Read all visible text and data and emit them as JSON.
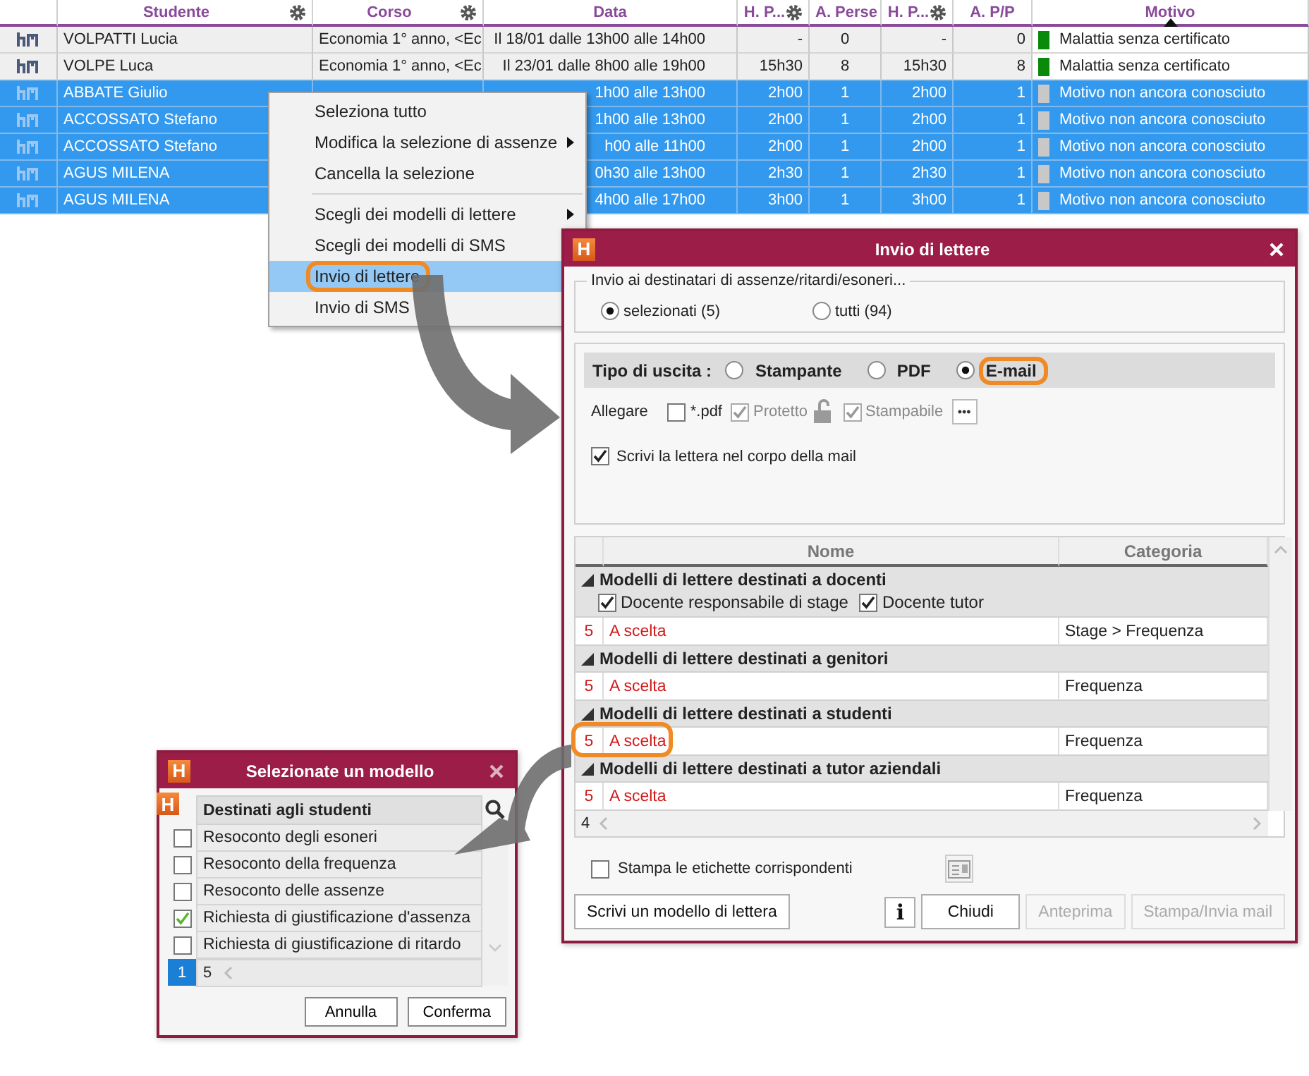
{
  "table": {
    "columns": [
      {
        "gear": false
      },
      {
        "label": "Studente",
        "gear": true
      },
      {
        "label": "Corso",
        "gear": true
      },
      {
        "label": "Data",
        "gear": false
      },
      {
        "label": "H. P...",
        "gear": true
      },
      {
        "label": "A. Perse",
        "gear": false
      },
      {
        "label": "H. P...",
        "gear": true
      },
      {
        "label": "A. P/P",
        "gear": false
      },
      {
        "label": "Motivo",
        "gear": false
      }
    ],
    "rows": [
      {
        "selected": false,
        "studente": "VOLPATTI Lucia",
        "corso": "Economia 1° anno, <Ec",
        "data": "Il 18/01 dalle 13h00 alle 14h00",
        "h_p_1": "-",
        "a_perse": "0",
        "h_p_2": "-",
        "a_p_p": "0",
        "motivo": "Malattia senza certificato",
        "color": "#0a8a0a"
      },
      {
        "selected": false,
        "studente": "VOLPE Luca",
        "corso": "Economia 1° anno, <Ec",
        "data": "Il 23/01 dalle 8h00 alle 19h00",
        "h_p_1": "15h30",
        "a_perse": "8",
        "h_p_2": "15h30",
        "a_p_p": "8",
        "motivo": "Malattia senza certificato",
        "color": "#0a8a0a"
      },
      {
        "selected": true,
        "studente": "ABBATE Giulio",
        "data": "1h00 alle 13h00",
        "h_p_1": "2h00",
        "a_perse": "1",
        "h_p_2": "2h00",
        "a_p_p": "1",
        "motivo": "Motivo non ancora conosciuto",
        "color": "#c8c8c8"
      },
      {
        "selected": true,
        "studente": "ACCOSSATO Stefano",
        "data": "1h00 alle 13h00",
        "h_p_1": "2h00",
        "a_perse": "1",
        "h_p_2": "2h00",
        "a_p_p": "1",
        "motivo": "Motivo non ancora conosciuto",
        "color": "#c8c8c8"
      },
      {
        "selected": true,
        "studente": "ACCOSSATO Stefano",
        "data": "h00 alle 11h00",
        "h_p_1": "2h00",
        "a_perse": "1",
        "h_p_2": "2h00",
        "a_p_p": "1",
        "motivo": "Motivo non ancora conosciuto",
        "color": "#c8c8c8"
      },
      {
        "selected": true,
        "studente": "AGUS MILENA",
        "data": "0h30 alle 13h00",
        "h_p_1": "2h30",
        "a_perse": "1",
        "h_p_2": "2h30",
        "a_p_p": "1",
        "motivo": "Motivo non ancora conosciuto",
        "color": "#c8c8c8"
      },
      {
        "selected": true,
        "studente": "AGUS MILENA",
        "data": "4h00 alle 17h00",
        "h_p_1": "3h00",
        "a_perse": "1",
        "h_p_2": "3h00",
        "a_p_p": "1",
        "motivo": "Motivo non ancora conosciuto",
        "color": "#c8c8c8"
      }
    ]
  },
  "context_menu": {
    "items": [
      {
        "kind": "item",
        "label": "Seleziona tutto",
        "submenu": false,
        "selected": false,
        "highlighted": false
      },
      {
        "kind": "item",
        "label": "Modifica la selezione di assenze",
        "submenu": true,
        "selected": false,
        "highlighted": false
      },
      {
        "kind": "item",
        "label": "Cancella la selezione",
        "submenu": false,
        "selected": false,
        "highlighted": false
      },
      {
        "kind": "separator"
      },
      {
        "kind": "item",
        "label": "Scegli dei modelli di lettere",
        "submenu": true,
        "selected": false,
        "highlighted": false
      },
      {
        "kind": "item",
        "label": "Scegli dei modelli di SMS",
        "selected": false,
        "highlighted": false
      },
      {
        "kind": "item",
        "label": "Invio di lettere",
        "selected": true,
        "highlighted": true
      },
      {
        "kind": "item",
        "label": "Invio di SMS",
        "selected": false,
        "highlighted": false
      }
    ]
  },
  "letters_dialog": {
    "logo": "H",
    "title": "Invio di lettere",
    "recipients": {
      "legend": "Invio ai destinatari di assenze/ritardi/esoneri...",
      "options": [
        {
          "label": "selezionati (5)",
          "selected": true
        },
        {
          "label": "tutti (94)",
          "selected": false
        }
      ]
    },
    "output": {
      "label": "Tipo di uscita :",
      "options": [
        {
          "label": "Stampante",
          "selected": false,
          "highlighted": false
        },
        {
          "label": "PDF",
          "selected": false,
          "highlighted": false
        },
        {
          "label": "E-mail",
          "selected": true,
          "highlighted": true
        }
      ]
    },
    "attach": {
      "label": "Allegare",
      "options": [
        {
          "label": "*.pdf",
          "checked": false,
          "disabled": false,
          "lock": false
        },
        {
          "label": "Protetto",
          "checked": true,
          "disabled": true,
          "lock": true
        },
        {
          "label": "Stampabile",
          "checked": true,
          "disabled": true,
          "lock": false
        }
      ],
      "more_button": "•••"
    },
    "write_in_body": {
      "label": "Scrivi la lettera nel corpo della mail",
      "checked": true
    },
    "models": {
      "columns": [
        "Nome",
        "Categoria"
      ],
      "groups": [
        {
          "title": "Modelli di lettere destinati a docenti",
          "expanded": true,
          "options": [
            {
              "label": "Docente responsabile di stage",
              "checked": true
            },
            {
              "label": "Docente tutor",
              "checked": true
            }
          ],
          "rows": [
            {
              "count": "5",
              "name": "A scelta",
              "category": "Stage > Frequenza",
              "highlighted": false
            }
          ]
        },
        {
          "title": "Modelli di lettere destinati a genitori",
          "expanded": true,
          "rows": [
            {
              "count": "5",
              "name": "A scelta",
              "category": "Frequenza",
              "highlighted": false
            }
          ]
        },
        {
          "title": "Modelli di lettere destinati a studenti",
          "expanded": true,
          "rows": [
            {
              "count": "5",
              "name": "A scelta",
              "category": "Frequenza",
              "highlighted": true
            }
          ]
        },
        {
          "title": "Modelli di lettere destinati a tutor aziendali",
          "expanded": true,
          "rows": [
            {
              "count": "5",
              "name": "A scelta",
              "category": "Frequenza",
              "highlighted": false
            }
          ]
        }
      ],
      "footer_count": "4"
    },
    "labels": {
      "label": "Stampa le etichette corrispondenti",
      "checked": false
    },
    "buttons": [
      {
        "kind": "text",
        "label": "Scrivi un modello di lettera",
        "disabled": false
      },
      {
        "kind": "info",
        "label": "i",
        "disabled": false
      },
      {
        "kind": "text",
        "label": "Chiudi",
        "disabled": false
      },
      {
        "kind": "text",
        "label": "Anteprima",
        "disabled": true
      },
      {
        "kind": "text",
        "label": "Stampa/Invia mail",
        "disabled": true
      }
    ]
  },
  "model_dialog": {
    "logo": "H",
    "title": "Selezionate un modello",
    "list_logo": "H",
    "header": "Destinati agli studenti",
    "items": [
      {
        "label": "Resoconto degli esoneri",
        "checked": false
      },
      {
        "label": "Resoconto della frequenza",
        "checked": false
      },
      {
        "label": "Resoconto delle assenze",
        "checked": false
      },
      {
        "label": "Richiesta di giustificazione d'assenza",
        "checked": true
      },
      {
        "label": "Richiesta di giustificazione di ritardo",
        "checked": false
      }
    ],
    "footer": {
      "index": "1",
      "count": "5"
    },
    "buttons": [
      "Annulla",
      "Conferma"
    ]
  }
}
